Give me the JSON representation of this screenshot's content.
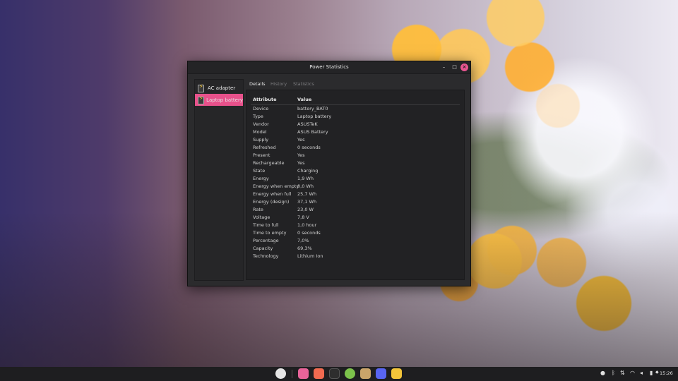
{
  "window": {
    "title": "Power Statistics",
    "minimize": "–",
    "maximize": "□",
    "close": "×"
  },
  "sidebar": {
    "items": [
      {
        "label": "AC adapter",
        "icon": "battery-charging-icon",
        "selected": false
      },
      {
        "label": "Laptop battery",
        "icon": "battery-charging-icon",
        "selected": true
      }
    ]
  },
  "tabs": [
    {
      "label": "Details",
      "active": true
    },
    {
      "label": "History",
      "active": false
    },
    {
      "label": "Statistics",
      "active": false
    }
  ],
  "table": {
    "headers": {
      "attribute": "Attribute",
      "value": "Value"
    },
    "rows": [
      {
        "attr": "Device",
        "value": "battery_BAT0"
      },
      {
        "attr": "Type",
        "value": "Laptop battery"
      },
      {
        "attr": "Vendor",
        "value": "ASUSTeK"
      },
      {
        "attr": "Model",
        "value": "ASUS Battery"
      },
      {
        "attr": "Supply",
        "value": "Yes"
      },
      {
        "attr": "Refreshed",
        "value": "0 seconds"
      },
      {
        "attr": "Present",
        "value": "Yes"
      },
      {
        "attr": "Rechargeable",
        "value": "Yes"
      },
      {
        "attr": "State",
        "value": "Charging"
      },
      {
        "attr": "Energy",
        "value": "1,9 Wh"
      },
      {
        "attr": "Energy when empty",
        "value": "0,0 Wh"
      },
      {
        "attr": "Energy when full",
        "value": "25,7 Wh"
      },
      {
        "attr": "Energy (design)",
        "value": "37,1 Wh"
      },
      {
        "attr": "Rate",
        "value": "23,0 W"
      },
      {
        "attr": "Voltage",
        "value": "7,8 V"
      },
      {
        "attr": "Time to full",
        "value": "1,0 hour"
      },
      {
        "attr": "Time to empty",
        "value": "0 seconds"
      },
      {
        "attr": "Percentage",
        "value": "7,0%"
      },
      {
        "attr": "Capacity",
        "value": "69,3%"
      },
      {
        "attr": "Technology",
        "value": "Lithium Ion"
      }
    ]
  },
  "taskbar": {
    "apps": [
      {
        "name": "mint-menu-icon",
        "color": "#e6e6e6"
      },
      {
        "name": "files-icon",
        "color": "#e8649a"
      },
      {
        "name": "app-store-icon",
        "color": "#f06a50"
      },
      {
        "name": "terminal-icon",
        "color": "#2e2e2e"
      },
      {
        "name": "chrome-icon",
        "color": "#7cc24b"
      },
      {
        "name": "archive-icon",
        "color": "#c9a46a"
      },
      {
        "name": "discord-icon",
        "color": "#5865f2"
      },
      {
        "name": "system-monitor-icon",
        "color": "#f3c53a"
      }
    ],
    "tray": [
      "discord-tray-icon",
      "bluetooth-icon",
      "network-icon",
      "wifi-icon",
      "volume-icon",
      "battery-icon",
      "notifications-icon"
    ],
    "clock": "15:26"
  },
  "colors": {
    "accent": "#e8518b",
    "window_bg": "#2b2b2d",
    "table_bg": "#222224"
  }
}
